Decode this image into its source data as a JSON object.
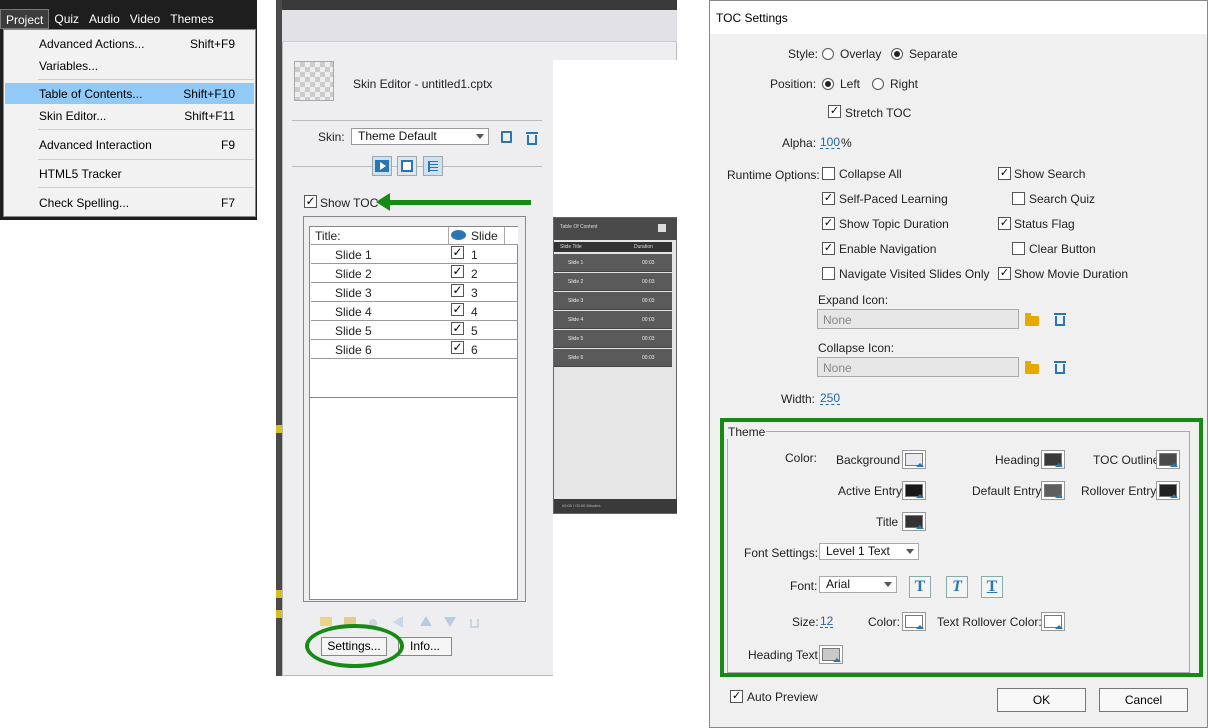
{
  "menu": {
    "bar": [
      "Project",
      "Quiz",
      "Audio",
      "Video",
      "Themes"
    ],
    "items": [
      {
        "label": "Advanced Actions...",
        "shortcut": "Shift+F9"
      },
      {
        "label": "Variables...",
        "shortcut": ""
      },
      {
        "label": "Table of Contents...",
        "shortcut": "Shift+F10",
        "selected": true
      },
      {
        "label": "Skin Editor...",
        "shortcut": "Shift+F11"
      },
      {
        "label": "Advanced Interaction",
        "shortcut": "F9"
      },
      {
        "label": "HTML5 Tracker",
        "shortcut": ""
      },
      {
        "label": "Check Spelling...",
        "shortcut": "F7"
      }
    ]
  },
  "skin": {
    "title": "Skin Editor - untitled1.cptx",
    "skin_label": "Skin:",
    "skin_value": "Theme Default",
    "show_toc_label": "Show TOC",
    "table": {
      "col_title": "Title:",
      "col_slide": "Slide",
      "rows": [
        {
          "title": "Slide 1",
          "num": "1"
        },
        {
          "title": "Slide 2",
          "num": "2"
        },
        {
          "title": "Slide 3",
          "num": "3"
        },
        {
          "title": "Slide 4",
          "num": "4"
        },
        {
          "title": "Slide 5",
          "num": "5"
        },
        {
          "title": "Slide 6",
          "num": "6"
        }
      ]
    },
    "settings_btn": "Settings...",
    "info_btn": "Info..."
  },
  "preview": {
    "heading": "Table Of Content",
    "col_title": "Slide Title",
    "col_duration": "Duration",
    "rows": [
      {
        "title": "Slide 1",
        "dur": "00:03"
      },
      {
        "title": "Slide 2",
        "dur": "00:03"
      },
      {
        "title": "Slide 3",
        "dur": "00:03"
      },
      {
        "title": "Slide 4",
        "dur": "00:03"
      },
      {
        "title": "Slide 5",
        "dur": "00:03"
      },
      {
        "title": "Slide 6",
        "dur": "00:03"
      }
    ],
    "footer": "00:00 / 00:00 Minutes"
  },
  "dialog": {
    "title": "TOC Settings",
    "style_label": "Style:",
    "style_overlay": "Overlay",
    "style_separate": "Separate",
    "position_label": "Position:",
    "pos_left": "Left",
    "pos_right": "Right",
    "stretch_toc": "Stretch TOC",
    "alpha_label": "Alpha:",
    "alpha_value": "100",
    "alpha_unit": "%",
    "runtime_label": "Runtime Options:",
    "opt": {
      "collapse_all": "Collapse All",
      "show_search": "Show Search",
      "self_paced": "Self-Paced Learning",
      "search_quiz": "Search Quiz",
      "topic_duration": "Show Topic Duration",
      "status_flag": "Status Flag",
      "enable_nav": "Enable Navigation",
      "clear_button": "Clear Button",
      "nav_visited": "Navigate Visited Slides Only",
      "movie_duration": "Show Movie Duration"
    },
    "expand_icon_label": "Expand Icon:",
    "expand_icon_value": "None",
    "collapse_icon_label": "Collapse Icon:",
    "collapse_icon_value": "None",
    "width_label": "Width:",
    "width_value": "250",
    "theme": {
      "group_label": "Theme",
      "color_label": "Color:",
      "background": "Background",
      "heading": "Heading",
      "toc_outline": "TOC Outline",
      "active_entry": "Active Entry",
      "default_entry": "Default Entry",
      "rollover_entry": "Rollover Entry",
      "title": "Title",
      "font_settings_label": "Font Settings:",
      "font_settings_value": "Level 1 Text",
      "font_label": "Font:",
      "font_value": "Arial",
      "size_label": "Size:",
      "size_value": "12",
      "text_color_label": "Color:",
      "text_rollover_label": "Text Rollover Color:",
      "heading_text_label": "Heading Text"
    },
    "auto_preview": "Auto Preview",
    "ok": "OK",
    "cancel": "Cancel"
  },
  "colors": {
    "highlight_green": "#158a15",
    "menu_selected": "#91c9f7",
    "link_blue": "#2266aa",
    "swatch_background": "#e8eaf0",
    "swatch_heading": "#3a3a3a",
    "swatch_outline": "#4a4a4a",
    "swatch_active": "#1a1a1a",
    "swatch_default": "#5e5e5e",
    "swatch_rollover": "#222222",
    "swatch_title": "#333333",
    "swatch_text": "#ffffff",
    "swatch_heading_text": "#c8c8c8"
  }
}
